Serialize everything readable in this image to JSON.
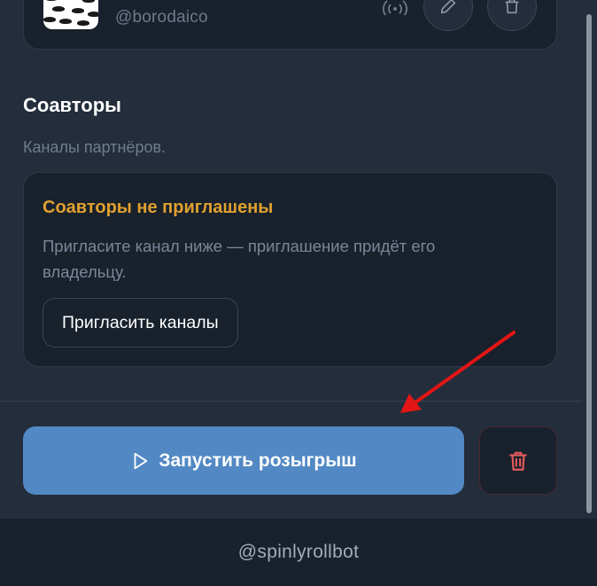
{
  "channel": {
    "handle": "@borodaico",
    "icons": {
      "signal": "broadcast-icon",
      "edit": "pencil-icon",
      "delete": "trash-icon"
    }
  },
  "coauthors": {
    "title": "Соавторы",
    "subtitle": "Каналы партнёров.",
    "empty_title": "Соавторы не приглашены",
    "empty_desc": "Пригласите канал ниже — приглашение придёт его владельцу.",
    "invite_label": "Пригласить каналы"
  },
  "actions": {
    "launch_label": "Запустить розыгрыш",
    "launch_icon": "play-icon",
    "delete_icon": "trash-icon"
  },
  "footer": {
    "bot_handle": "@spinlyrollbot"
  },
  "colors": {
    "background": "#232d3b",
    "card": "#18212c",
    "accent_blue": "#5289c4",
    "warning_orange": "#e0a030",
    "danger_red": "#e05a5a",
    "annotation_red": "#e41515"
  }
}
